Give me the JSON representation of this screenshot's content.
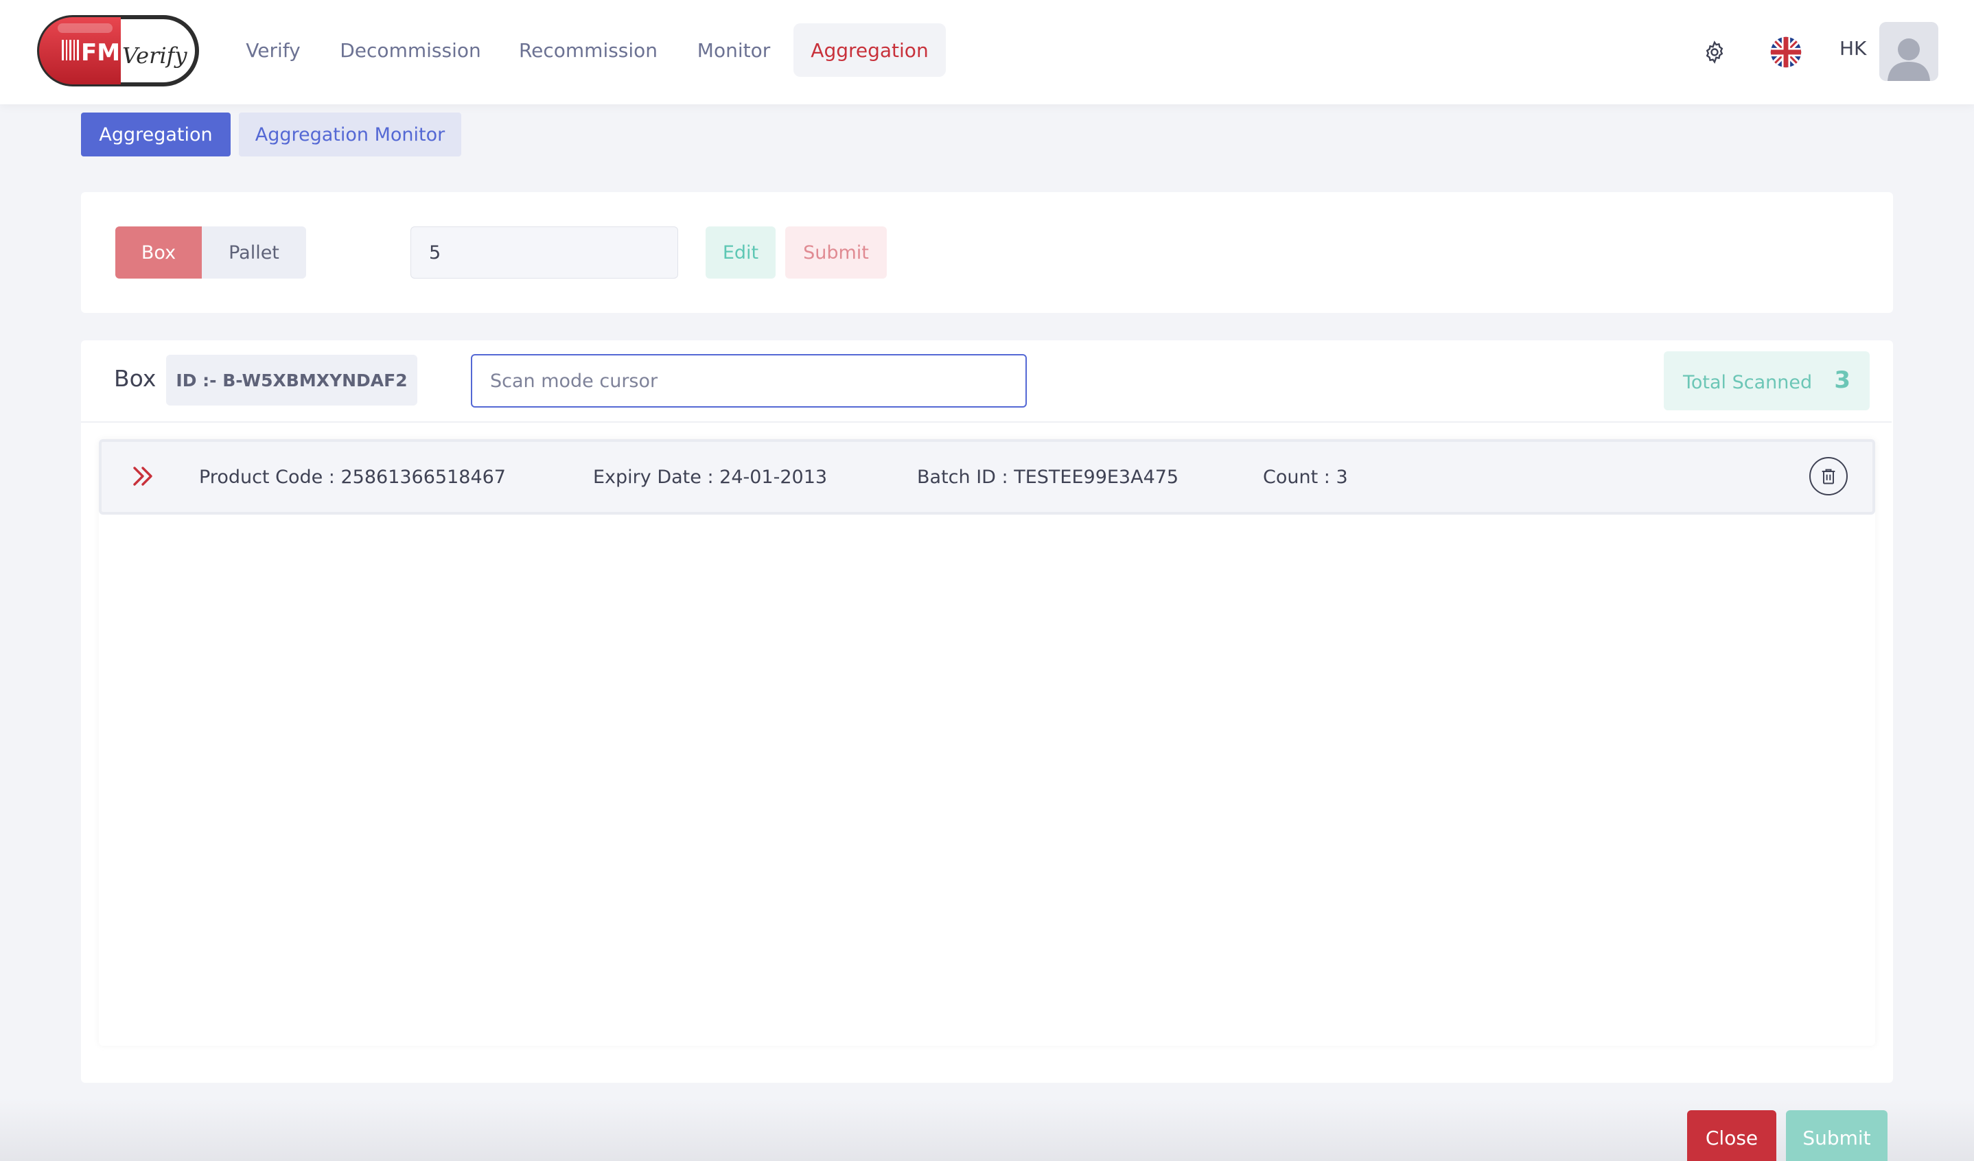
{
  "app": {
    "logo_text": "FMVerify"
  },
  "nav": {
    "items": [
      {
        "label": "Verify"
      },
      {
        "label": "Decommission"
      },
      {
        "label": "Recommission"
      },
      {
        "label": "Monitor"
      },
      {
        "label": "Aggregation",
        "active": true
      }
    ]
  },
  "header": {
    "settings_icon": "gear-icon",
    "language_icon": "uk-flag-icon",
    "user_initials": "HK",
    "avatar_icon": "user-avatar-icon"
  },
  "subtabs": [
    {
      "label": "Aggregation",
      "active": true
    },
    {
      "label": "Aggregation Monitor",
      "active": false
    }
  ],
  "config": {
    "mode_options": [
      "Box",
      "Pallet"
    ],
    "selected_mode": "Box",
    "quantity_value": "5",
    "edit_label": "Edit",
    "submit_label": "Submit"
  },
  "box_panel": {
    "title": "Box",
    "id_text": "ID :- B-W5XBMXYNDAF2",
    "scan_placeholder": "Scan mode cursor",
    "total_scanned_label": "Total Scanned",
    "total_scanned_value": "3"
  },
  "items": [
    {
      "product_code": "Product Code : 25861366518467",
      "expiry_date": "Expiry Date : 24-01-2013",
      "batch_id": "Batch ID : TESTEE99E3A475",
      "count": "Count : 3"
    }
  ],
  "footer": {
    "close_label": "Close",
    "submit_label": "Submit"
  },
  "colors": {
    "brand_red": "#c8313b",
    "accent_blue": "#5468d4",
    "teal": "#6cc6b6"
  }
}
